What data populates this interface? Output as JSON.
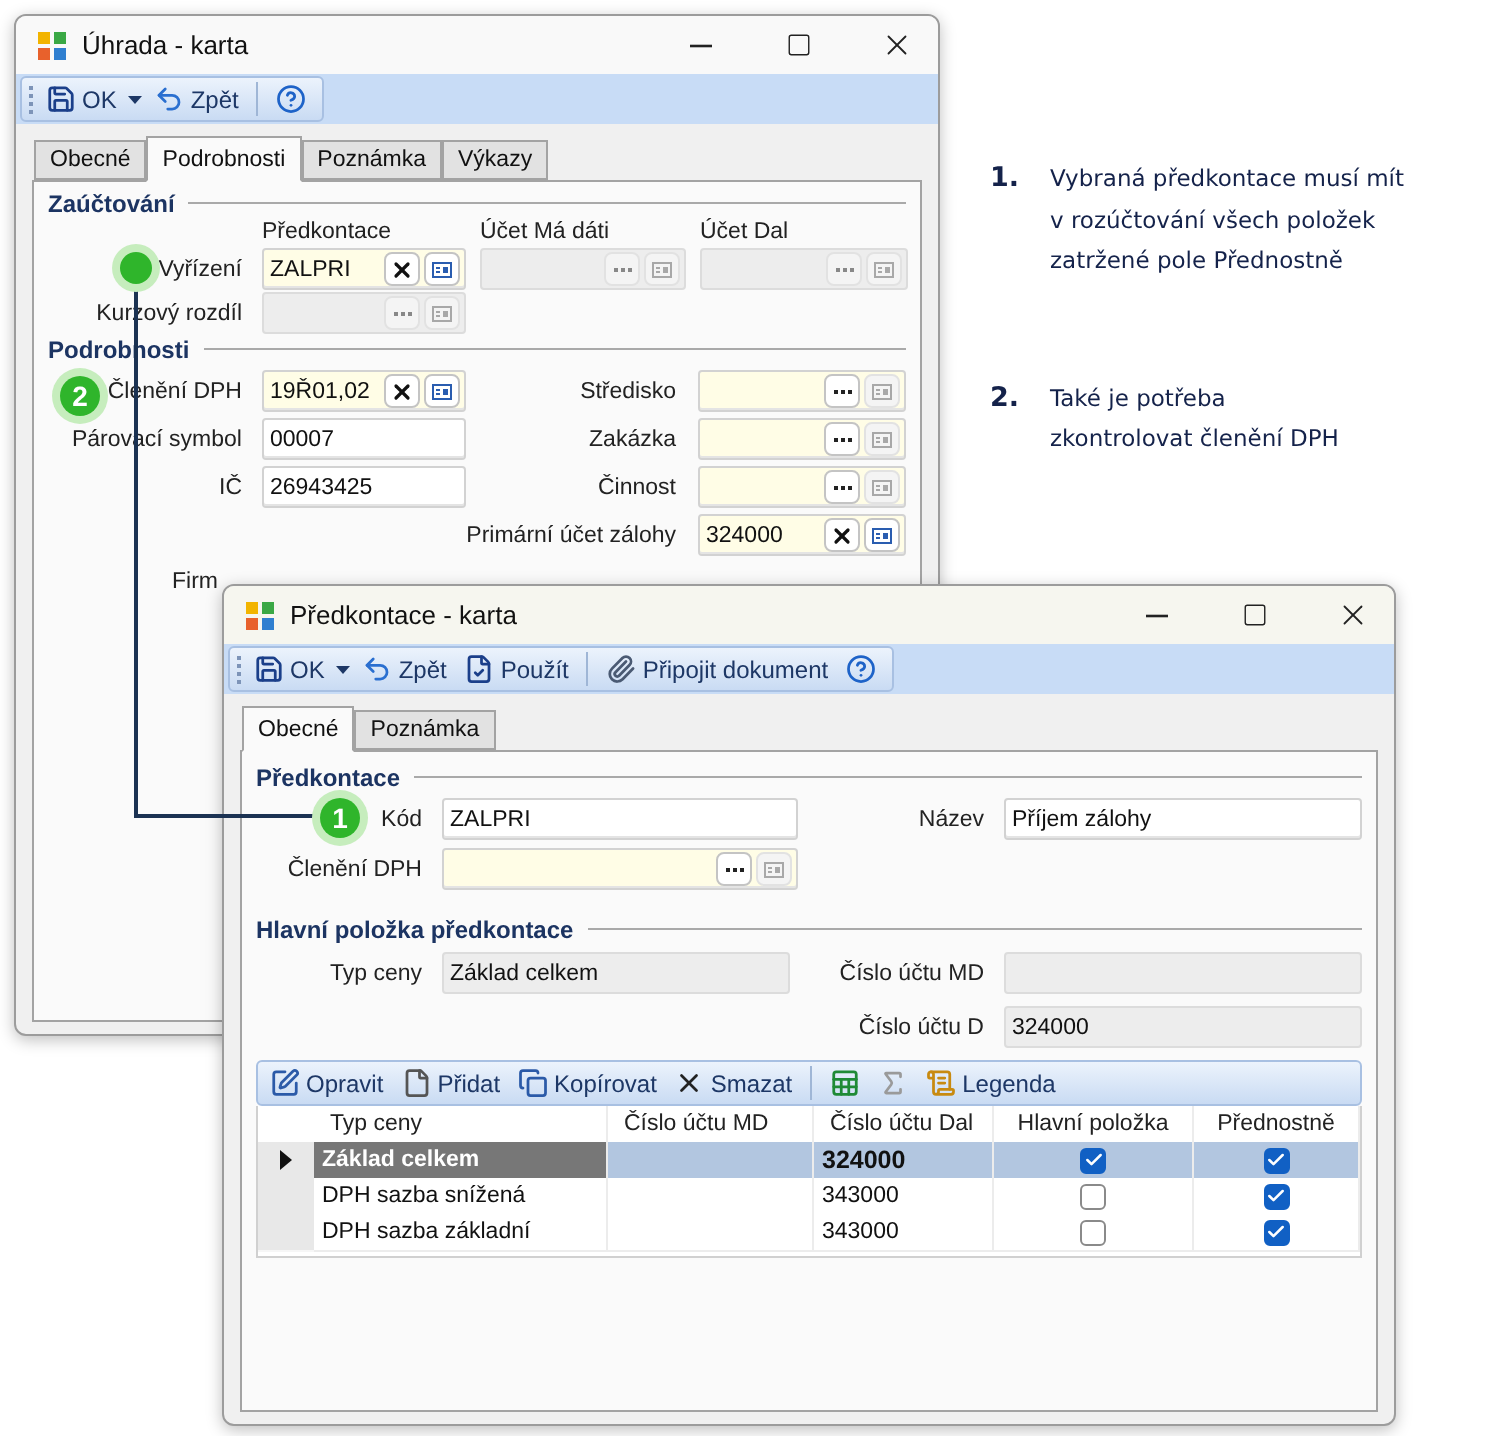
{
  "main_window": {
    "title": "Úhrada - karta",
    "toolbar": [
      [
        {
          "kind": "save",
          "label": "OK",
          "dropdown": true
        },
        {
          "kind": "undo",
          "label": "Zpět"
        }
      ],
      [
        {
          "kind": "help"
        }
      ]
    ],
    "tabs": [
      {
        "label": "Obecné",
        "selected": false
      },
      {
        "label": "Podrobnosti",
        "selected": true
      },
      {
        "label": "Poznámka",
        "selected": false
      },
      {
        "label": "Výkazy",
        "selected": false
      }
    ],
    "posting": {
      "heading": "Zaúčtování",
      "columns": [
        "Předkontace",
        "Účet Má dáti",
        "Účet Dal"
      ],
      "rows": [
        {
          "label": "Vyřízení",
          "fields": [
            {
              "kind": "lookup",
              "value": "ZALPRI",
              "required": true,
              "disabled": false
            },
            {
              "kind": "lookup",
              "required": false,
              "disabled": true
            },
            {
              "kind": "lookup",
              "required": false,
              "disabled": true
            }
          ]
        },
        {
          "label": "Kurzový rozdíl",
          "fields": [
            {
              "kind": "lookup",
              "required": false,
              "disabled": true
            }
          ]
        }
      ]
    },
    "details": {
      "heading": "Podrobnosti",
      "rows": [
        {
          "left": {
            "label": "Členění DPH",
            "kind": "lookup",
            "value": "19Ř01,02",
            "required": true,
            "disabled": false
          },
          "right": {
            "label": "Středisko",
            "kind": "lookup",
            "required": true,
            "disabled": false
          }
        },
        {
          "left": {
            "label": "Párovací symbol",
            "kind": "text",
            "value": "00007",
            "required": false,
            "disabled": false
          },
          "right": {
            "label": "Zakázka",
            "kind": "lookup",
            "required": true,
            "disabled": false
          }
        },
        {
          "left": {
            "label": "IČ",
            "kind": "text",
            "value": "26943425",
            "required": false,
            "disabled": false
          },
          "right": {
            "label": "Činnost",
            "kind": "lookup",
            "required": true,
            "disabled": false
          }
        },
        {
          "right": {
            "label": "Primární účet zálohy",
            "kind": "lookup",
            "value": "324000",
            "required": true,
            "disabled": false
          }
        },
        {
          "left": {
            "label": "Firm",
            "kind": "covered"
          }
        }
      ]
    }
  },
  "card_window": {
    "title": "Předkontace - karta",
    "toolbar": [
      [
        {
          "kind": "save",
          "label": "OK",
          "dropdown": true
        },
        {
          "kind": "undo",
          "label": "Zpět"
        },
        {
          "kind": "apply",
          "label": "Použít"
        }
      ],
      [
        {
          "kind": "attach",
          "label": "Připojit dokument"
        },
        {
          "kind": "help"
        }
      ]
    ],
    "tabs": [
      {
        "label": "Obecné",
        "selected": true
      },
      {
        "label": "Poznámka",
        "selected": false
      }
    ],
    "header": {
      "heading": "Předkontace",
      "rows": [
        {
          "left": {
            "label": "Kód",
            "kind": "text",
            "value": "ZALPRI",
            "required": false,
            "disabled": false
          },
          "right": {
            "label": "Název",
            "kind": "text",
            "value": "Příjem zálohy",
            "required": false,
            "disabled": false
          }
        },
        {
          "left": {
            "label": "Členění DPH",
            "kind": "lookup",
            "required": true,
            "disabled": false
          }
        }
      ]
    },
    "main_item": {
      "heading": "Hlavní položka předkontace",
      "rows": [
        {
          "left": {
            "label": "Typ ceny",
            "kind": "text",
            "value": "Základ celkem",
            "required": false,
            "disabled": true
          },
          "right": {
            "label": "Číslo účtu MD",
            "kind": "text",
            "required": false,
            "disabled": true
          }
        },
        {
          "right": {
            "label": "Číslo účtu D",
            "kind": "text",
            "value": "324000",
            "required": false,
            "disabled": true
          }
        }
      ]
    },
    "grid_toolbar": [
      [
        {
          "kind": "edit",
          "label": "Opravit"
        },
        {
          "kind": "add",
          "label": "Přidat"
        },
        {
          "kind": "copy",
          "label": "Kopírovat"
        },
        {
          "kind": "delete",
          "label": "Smazat"
        }
      ],
      [
        {
          "kind": "excel"
        },
        {
          "kind": "sum"
        },
        {
          "kind": "legend",
          "label": "Legenda"
        }
      ]
    ],
    "table": {
      "columns": [
        "Typ ceny",
        "Číslo účtu MD",
        "Číslo účtu Dal",
        "Hlavní položka",
        "Přednostně"
      ],
      "rows": [
        {
          "price_type": "Základ celkem",
          "account_dal": "324000",
          "main": true,
          "preferred": true,
          "selected": true
        },
        {
          "price_type": "DPH sazba snížená",
          "account_dal": "343000",
          "main": false,
          "preferred": true,
          "selected": false
        },
        {
          "price_type": "DPH sazba základní",
          "account_dal": "343000",
          "main": false,
          "preferred": true,
          "selected": false
        }
      ]
    }
  },
  "annotations": {
    "markers": [
      {
        "label": "2"
      },
      {
        "label": "1"
      }
    ],
    "notes": [
      {
        "number": "1.",
        "lines": [
          "Vybraná předkontace musí mít",
          "v rozúčtování všech položek",
          "zatržené pole Přednostně"
        ]
      },
      {
        "number": "2.",
        "lines": [
          "Také je potřeba",
          "zkontrolovat členění DPH"
        ]
      }
    ]
  }
}
